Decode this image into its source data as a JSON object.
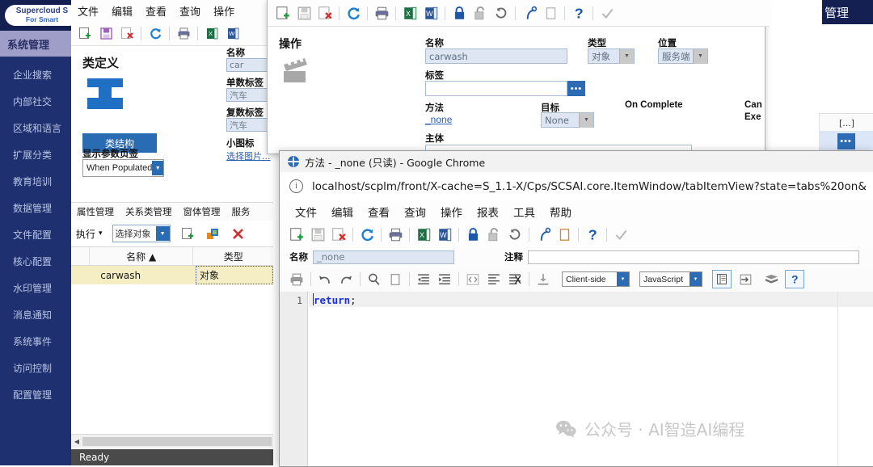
{
  "brand": {
    "line1": "Supercloud S",
    "line2": "For Smart"
  },
  "sidebar": {
    "active": "系统管理",
    "items": [
      {
        "label": "企业搜索"
      },
      {
        "label": "内部社交"
      },
      {
        "label": "区域和语言"
      },
      {
        "label": "扩展分类"
      },
      {
        "label": "教育培训"
      },
      {
        "label": "数据管理"
      },
      {
        "label": "文件配置"
      },
      {
        "label": "核心配置"
      },
      {
        "label": "水印管理"
      },
      {
        "label": "消息通知"
      },
      {
        "label": "系统事件"
      },
      {
        "label": "访问控制"
      },
      {
        "label": "配置管理"
      }
    ]
  },
  "main_window": {
    "menus": [
      "文件",
      "编辑",
      "查看",
      "查询",
      "操作"
    ],
    "classdef": {
      "title": "类定义",
      "structure_button": "类结构",
      "show_param_label": "显示参数页签",
      "show_param_value": "When Populated"
    },
    "form": {
      "name_label": "名称",
      "name_value": "car",
      "singular_label": "单数标签",
      "singular_value": "汽车",
      "plural_label": "复数标签",
      "plural_value": "汽车",
      "icon_label": "小图标",
      "icon_link": "选择图片..."
    },
    "tabs": [
      "属性管理",
      "关系类管理",
      "窗体管理",
      "服务"
    ],
    "action_row": {
      "execute_label": "执行",
      "select_object_value": "选择对象"
    },
    "table": {
      "columns": [
        "名称 ▲",
        "类型"
      ],
      "rows": [
        {
          "name": "carwash",
          "type": "对象"
        }
      ]
    },
    "status_text": "Ready"
  },
  "right_panel": {
    "title": "管理",
    "cell_header": "[...]",
    "dots_button": "•••"
  },
  "action_dialog": {
    "title": "操作",
    "name_label": "名称",
    "name_value": "carwash",
    "type_label": "类型",
    "type_value": "对象",
    "position_label": "位置",
    "position_value": "服务端",
    "tag_label": "标签",
    "tag_value": "",
    "ellipsis_button": "•••",
    "method_label": "方法",
    "method_value": "_none",
    "target_label": "目标",
    "target_value": "None",
    "on_complete_label": "On Complete",
    "can_exec_line1": "Can",
    "can_exec_line2": "Exe",
    "body_label": "主体"
  },
  "chrome_window": {
    "title": "方法 - _none (只读) - Google Chrome",
    "url": "localhost/scplm/front/X-cache=S_1.1-X/Cps/SCSAI.core.ItemWindow/tabItemView?state=tabs%20on&",
    "menus": [
      "文件",
      "编辑",
      "查看",
      "查询",
      "操作",
      "报表",
      "工具",
      "帮助"
    ],
    "name_label": "名称",
    "name_value": "_none",
    "comment_label": "注释",
    "comment_value": "",
    "editor": {
      "scope_value": "Client-side",
      "language_value": "JavaScript",
      "line_number": "1",
      "code_keyword": "return",
      "code_punct": ";"
    }
  },
  "watermark": {
    "text": "公众号 · AI智造AI编程"
  },
  "colors": {
    "nav_bg": "#1e3070",
    "nav_brand": "#141f52",
    "nav_active": "#9e9ec8",
    "accent_blue": "#2d6cb5",
    "field_blue": "#dde6f2",
    "row_highlight": "#f5eec4",
    "status_bar": "#4a4a4a"
  }
}
